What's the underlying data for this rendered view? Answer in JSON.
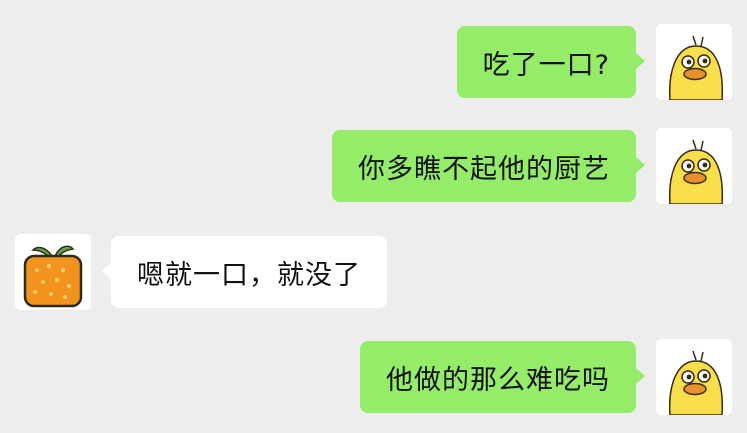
{
  "colors": {
    "chat_background": "#ededed",
    "outgoing_bubble": "#95ec69",
    "incoming_bubble": "#ffffff",
    "text": "#111111"
  },
  "messages": [
    {
      "direction": "outgoing",
      "text": "吃了一口?",
      "avatar": "yellow-duck-avatar"
    },
    {
      "direction": "outgoing",
      "text": "你多瞧不起他的厨艺",
      "avatar": "yellow-duck-avatar"
    },
    {
      "direction": "incoming",
      "text": "嗯就一口，就没了",
      "avatar": "orange-fruit-avatar"
    },
    {
      "direction": "outgoing",
      "text": "他做的那么难吃吗",
      "avatar": "yellow-duck-avatar"
    }
  ]
}
